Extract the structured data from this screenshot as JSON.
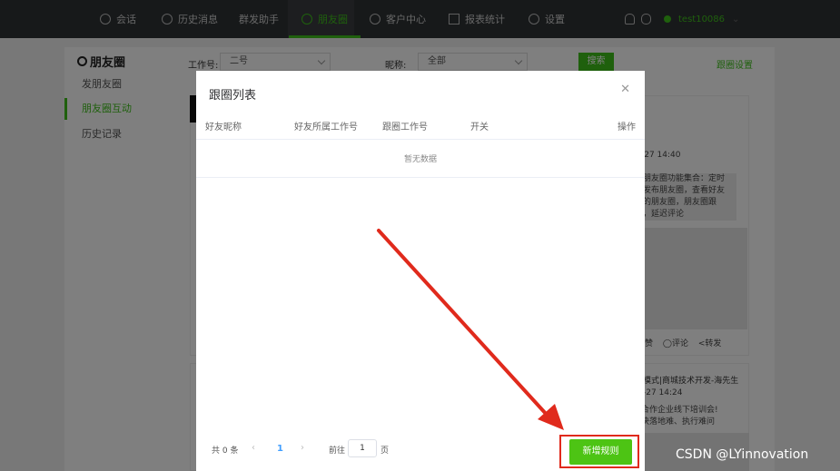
{
  "topnav": {
    "items": [
      {
        "label": "会话",
        "icon": "chat-icon"
      },
      {
        "label": "历史消息",
        "icon": "clock-icon"
      },
      {
        "label": "群发助手",
        "icon": ""
      },
      {
        "label": "朋友圈",
        "icon": "moments-icon",
        "active": true
      },
      {
        "label": "客户中心",
        "icon": "user-icon"
      },
      {
        "label": "报表统计",
        "icon": "bar-chart-icon"
      },
      {
        "label": "设置",
        "icon": "gear-icon"
      }
    ],
    "username": "test10086"
  },
  "sidebar": {
    "title": "朋友圈",
    "items": [
      {
        "label": "发朋友圈"
      },
      {
        "label": "朋友圈互动",
        "active": true
      },
      {
        "label": "历史记录"
      }
    ]
  },
  "filters": {
    "work_label": "工作号:",
    "work_value": "二号",
    "nickname_label": "昵称:",
    "nickname_value": "全部",
    "search_label": "搜索",
    "follow_settings": "跟圈设置"
  },
  "background_posts": {
    "post1_time": "-27 14:40",
    "post1_text": [
      "朋友圈功能集合：定时",
      "发布朋友圈，查看好友",
      "的朋友圈，朋友圈跟",
      "，延迟评论"
    ],
    "post1_like": "赞",
    "post1_comment": "◯评论",
    "post1_share": "<转发",
    "post2_title": "模式|商城技术开发-海先生",
    "post2_time": "-27 14:24",
    "post2_text": [
      "合作企业线下培训会!",
      "决落地难、执行难问"
    ]
  },
  "modal": {
    "title": "跟圈列表",
    "columns": [
      "好友昵称",
      "好友所属工作号",
      "跟圈工作号",
      "开关",
      "操作"
    ],
    "empty_text": "暂无数据",
    "pager": {
      "total": "共 0 条",
      "prev": "‹",
      "page": "1",
      "next": "›",
      "goto_label": "前往",
      "goto_value": "1",
      "goto_unit": "页"
    },
    "add_rule": "新增规则"
  },
  "colors": {
    "brand_green": "#3ec01a",
    "nav_bg": "#2f3235",
    "annotation_red": "#e02a1c"
  },
  "watermark": "CSDN @LYinnovation"
}
